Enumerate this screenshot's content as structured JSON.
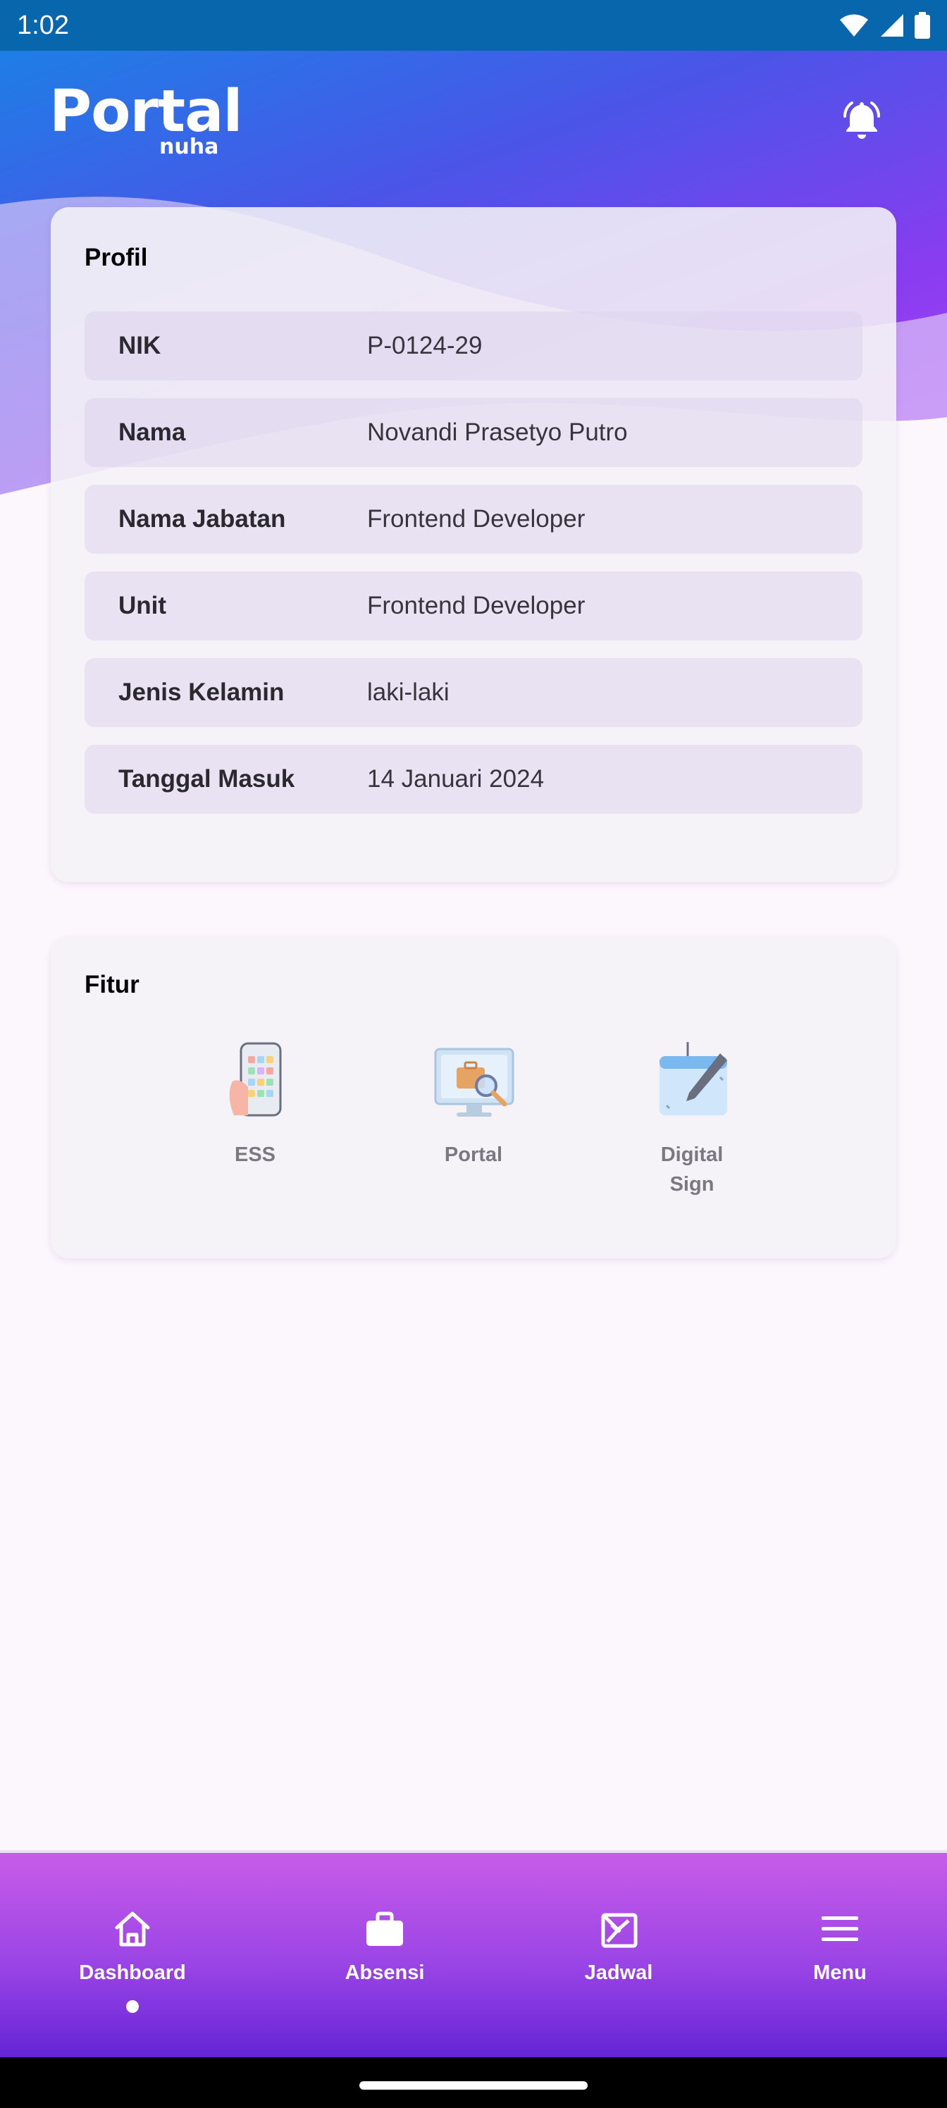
{
  "status_bar": {
    "time": "1:02"
  },
  "header": {
    "brand_main": "Portal",
    "brand_sub": "nuha",
    "notification_icon": "bell-ringing-icon"
  },
  "profile": {
    "title": "Profil",
    "rows": [
      {
        "label": "NIK",
        "value": "P-0124-29"
      },
      {
        "label": "Nama",
        "value": "Novandi Prasetyo Putro"
      },
      {
        "label": "Nama Jabatan",
        "value": "Frontend Developer"
      },
      {
        "label": "Unit",
        "value": "Frontend Developer"
      },
      {
        "label": "Jenis Kelamin",
        "value": "laki-laki"
      },
      {
        "label": "Tanggal Masuk",
        "value": "14 Januari 2024"
      }
    ]
  },
  "features": {
    "title": "Fitur",
    "items": [
      {
        "label": "ESS",
        "icon": "phone-apps-icon"
      },
      {
        "label": "Portal",
        "icon": "monitor-briefcase-search-icon"
      },
      {
        "label": "Digital Sign",
        "icon": "calendar-pen-icon"
      }
    ]
  },
  "bottom_nav": {
    "items": [
      {
        "label": "Dashboard",
        "icon": "home-icon",
        "active": true
      },
      {
        "label": "Absensi",
        "icon": "briefcase-icon",
        "active": false
      },
      {
        "label": "Jadwal",
        "icon": "schedule-icon",
        "active": false
      },
      {
        "label": "Menu",
        "icon": "hamburger-menu-icon",
        "active": false
      }
    ]
  },
  "colors": {
    "status_bar": "#0866ad",
    "header_start": "#1e7ee6",
    "header_end": "#a44cf4",
    "nav_start": "#c85ce8",
    "nav_end": "#6424d6",
    "background": "#fcf6fd"
  }
}
